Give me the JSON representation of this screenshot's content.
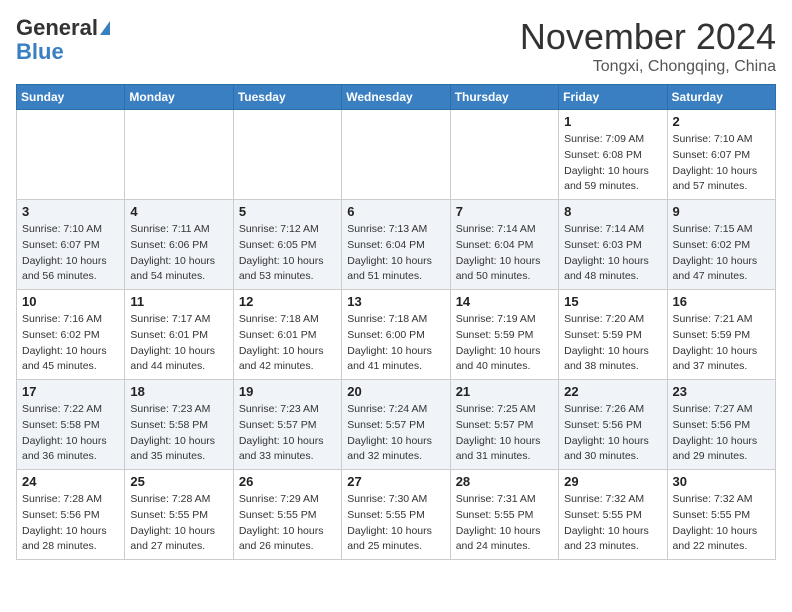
{
  "header": {
    "logo_line1": "General",
    "logo_line2": "Blue",
    "month": "November 2024",
    "location": "Tongxi, Chongqing, China"
  },
  "weekdays": [
    "Sunday",
    "Monday",
    "Tuesday",
    "Wednesday",
    "Thursday",
    "Friday",
    "Saturday"
  ],
  "weeks": [
    [
      {
        "day": "",
        "info": ""
      },
      {
        "day": "",
        "info": ""
      },
      {
        "day": "",
        "info": ""
      },
      {
        "day": "",
        "info": ""
      },
      {
        "day": "",
        "info": ""
      },
      {
        "day": "1",
        "info": "Sunrise: 7:09 AM\nSunset: 6:08 PM\nDaylight: 10 hours\nand 59 minutes."
      },
      {
        "day": "2",
        "info": "Sunrise: 7:10 AM\nSunset: 6:07 PM\nDaylight: 10 hours\nand 57 minutes."
      }
    ],
    [
      {
        "day": "3",
        "info": "Sunrise: 7:10 AM\nSunset: 6:07 PM\nDaylight: 10 hours\nand 56 minutes."
      },
      {
        "day": "4",
        "info": "Sunrise: 7:11 AM\nSunset: 6:06 PM\nDaylight: 10 hours\nand 54 minutes."
      },
      {
        "day": "5",
        "info": "Sunrise: 7:12 AM\nSunset: 6:05 PM\nDaylight: 10 hours\nand 53 minutes."
      },
      {
        "day": "6",
        "info": "Sunrise: 7:13 AM\nSunset: 6:04 PM\nDaylight: 10 hours\nand 51 minutes."
      },
      {
        "day": "7",
        "info": "Sunrise: 7:14 AM\nSunset: 6:04 PM\nDaylight: 10 hours\nand 50 minutes."
      },
      {
        "day": "8",
        "info": "Sunrise: 7:14 AM\nSunset: 6:03 PM\nDaylight: 10 hours\nand 48 minutes."
      },
      {
        "day": "9",
        "info": "Sunrise: 7:15 AM\nSunset: 6:02 PM\nDaylight: 10 hours\nand 47 minutes."
      }
    ],
    [
      {
        "day": "10",
        "info": "Sunrise: 7:16 AM\nSunset: 6:02 PM\nDaylight: 10 hours\nand 45 minutes."
      },
      {
        "day": "11",
        "info": "Sunrise: 7:17 AM\nSunset: 6:01 PM\nDaylight: 10 hours\nand 44 minutes."
      },
      {
        "day": "12",
        "info": "Sunrise: 7:18 AM\nSunset: 6:01 PM\nDaylight: 10 hours\nand 42 minutes."
      },
      {
        "day": "13",
        "info": "Sunrise: 7:18 AM\nSunset: 6:00 PM\nDaylight: 10 hours\nand 41 minutes."
      },
      {
        "day": "14",
        "info": "Sunrise: 7:19 AM\nSunset: 5:59 PM\nDaylight: 10 hours\nand 40 minutes."
      },
      {
        "day": "15",
        "info": "Sunrise: 7:20 AM\nSunset: 5:59 PM\nDaylight: 10 hours\nand 38 minutes."
      },
      {
        "day": "16",
        "info": "Sunrise: 7:21 AM\nSunset: 5:59 PM\nDaylight: 10 hours\nand 37 minutes."
      }
    ],
    [
      {
        "day": "17",
        "info": "Sunrise: 7:22 AM\nSunset: 5:58 PM\nDaylight: 10 hours\nand 36 minutes."
      },
      {
        "day": "18",
        "info": "Sunrise: 7:23 AM\nSunset: 5:58 PM\nDaylight: 10 hours\nand 35 minutes."
      },
      {
        "day": "19",
        "info": "Sunrise: 7:23 AM\nSunset: 5:57 PM\nDaylight: 10 hours\nand 33 minutes."
      },
      {
        "day": "20",
        "info": "Sunrise: 7:24 AM\nSunset: 5:57 PM\nDaylight: 10 hours\nand 32 minutes."
      },
      {
        "day": "21",
        "info": "Sunrise: 7:25 AM\nSunset: 5:57 PM\nDaylight: 10 hours\nand 31 minutes."
      },
      {
        "day": "22",
        "info": "Sunrise: 7:26 AM\nSunset: 5:56 PM\nDaylight: 10 hours\nand 30 minutes."
      },
      {
        "day": "23",
        "info": "Sunrise: 7:27 AM\nSunset: 5:56 PM\nDaylight: 10 hours\nand 29 minutes."
      }
    ],
    [
      {
        "day": "24",
        "info": "Sunrise: 7:28 AM\nSunset: 5:56 PM\nDaylight: 10 hours\nand 28 minutes."
      },
      {
        "day": "25",
        "info": "Sunrise: 7:28 AM\nSunset: 5:55 PM\nDaylight: 10 hours\nand 27 minutes."
      },
      {
        "day": "26",
        "info": "Sunrise: 7:29 AM\nSunset: 5:55 PM\nDaylight: 10 hours\nand 26 minutes."
      },
      {
        "day": "27",
        "info": "Sunrise: 7:30 AM\nSunset: 5:55 PM\nDaylight: 10 hours\nand 25 minutes."
      },
      {
        "day": "28",
        "info": "Sunrise: 7:31 AM\nSunset: 5:55 PM\nDaylight: 10 hours\nand 24 minutes."
      },
      {
        "day": "29",
        "info": "Sunrise: 7:32 AM\nSunset: 5:55 PM\nDaylight: 10 hours\nand 23 minutes."
      },
      {
        "day": "30",
        "info": "Sunrise: 7:32 AM\nSunset: 5:55 PM\nDaylight: 10 hours\nand 22 minutes."
      }
    ]
  ]
}
